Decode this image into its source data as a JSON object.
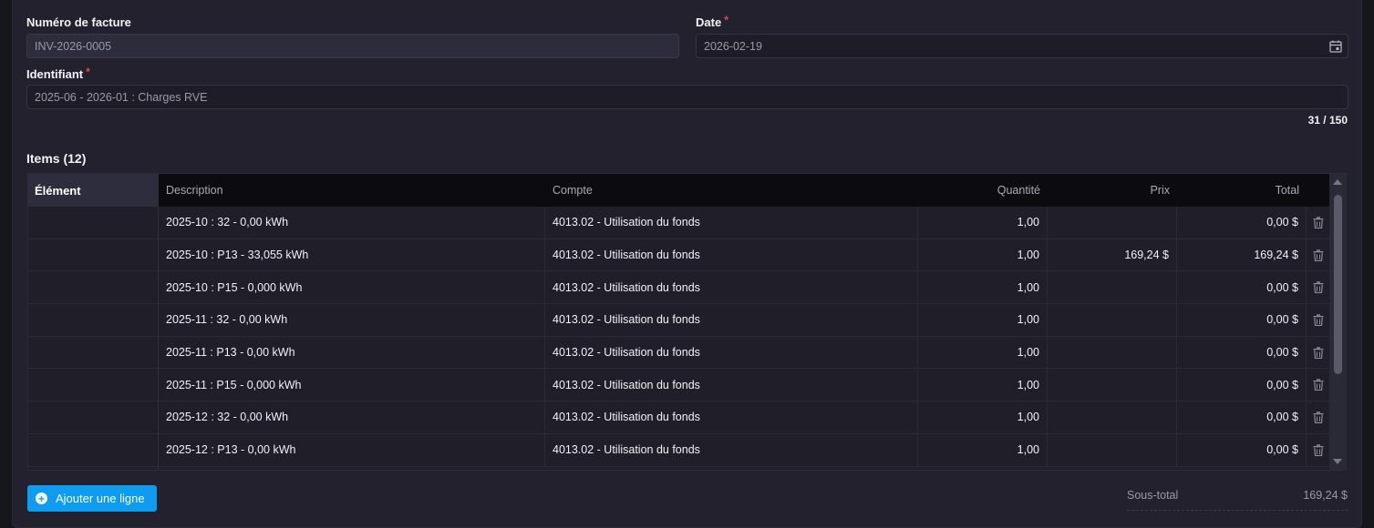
{
  "invoice_number": {
    "label": "Numéro de facture",
    "value": "INV-2026-0005"
  },
  "date": {
    "label": "Date",
    "required_mark": "*",
    "value": "2026-02-19",
    "icon": "calendar-icon"
  },
  "identifier": {
    "label": "Identifiant",
    "required_mark": "*",
    "value": "2025-06 - 2026-01 : Charges RVE",
    "counter": "31 / 150"
  },
  "items": {
    "title": "Items (12)",
    "columns": {
      "element": "Élément",
      "description": "Description",
      "account": "Compte",
      "quantity": "Quantité",
      "price": "Prix",
      "total": "Total"
    },
    "rows": [
      {
        "description": "2025-10 : 32 - 0,00 kWh",
        "account": "4013.02 - Utilisation du fonds",
        "quantity": "1,00",
        "price": "",
        "total": "0,00 $"
      },
      {
        "description": "2025-10 : P13 - 33,055 kWh",
        "account": "4013.02 - Utilisation du fonds",
        "quantity": "1,00",
        "price": "169,24 $",
        "total": "169,24 $"
      },
      {
        "description": "2025-10 : P15 - 0,000 kWh",
        "account": "4013.02 - Utilisation du fonds",
        "quantity": "1,00",
        "price": "",
        "total": "0,00 $"
      },
      {
        "description": "2025-11 : 32 - 0,00 kWh",
        "account": "4013.02 - Utilisation du fonds",
        "quantity": "1,00",
        "price": "",
        "total": "0,00 $"
      },
      {
        "description": "2025-11 : P13 - 0,00 kWh",
        "account": "4013.02 - Utilisation du fonds",
        "quantity": "1,00",
        "price": "",
        "total": "0,00 $"
      },
      {
        "description": "2025-11 : P15 - 0,000 kWh",
        "account": "4013.02 - Utilisation du fonds",
        "quantity": "1,00",
        "price": "",
        "total": "0,00 $"
      },
      {
        "description": "2025-12 : 32 - 0,00 kWh",
        "account": "4013.02 - Utilisation du fonds",
        "quantity": "1,00",
        "price": "",
        "total": "0,00 $"
      },
      {
        "description": "2025-12 : P13 - 0,00 kWh",
        "account": "4013.02 - Utilisation du fonds",
        "quantity": "1,00",
        "price": "",
        "total": "0,00 $"
      }
    ],
    "row_action_icon": "trash-icon"
  },
  "add_line_button": {
    "label": "Ajouter une ligne",
    "icon": "plus-circle-icon"
  },
  "subtotal": {
    "label": "Sous-total",
    "value": "169,24 $"
  },
  "colors": {
    "accent": "#0d9cf0",
    "required": "#e5484d",
    "background": "#22212d"
  }
}
